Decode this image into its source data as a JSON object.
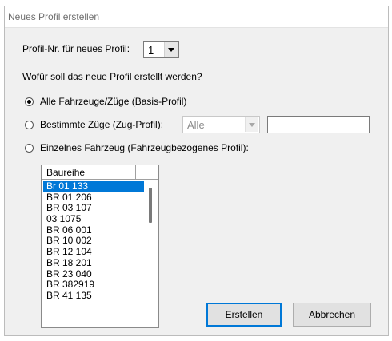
{
  "window": {
    "title": "Neues Profil erstellen"
  },
  "profile_number": {
    "label": "Profil-Nr. für neues Profil:",
    "value": "1"
  },
  "question": "Wofür soll das neue Profil erstellt werden?",
  "options": [
    {
      "label": "Alle Fahrzeuge/Züge (Basis-Profil)",
      "checked": true
    },
    {
      "label": "Bestimmte Züge (Zug-Profil):",
      "checked": false
    },
    {
      "label": "Einzelnes Fahrzeug (Fahrzeugbezogenes Profil):",
      "checked": false
    }
  ],
  "zug_filter": {
    "value": "Alle",
    "text": ""
  },
  "list": {
    "header": "Baureihe",
    "items": [
      "Br 01 133",
      "BR 01 206",
      "BR 03 107",
      "03 1075",
      "BR 06 001",
      "BR 10 002",
      "BR 12 104",
      "BR 18 201",
      "BR 23 040",
      "BR 382919",
      "BR 41 135"
    ],
    "selected_index": 0
  },
  "buttons": {
    "create": "Erstellen",
    "cancel": "Abbrechen"
  }
}
